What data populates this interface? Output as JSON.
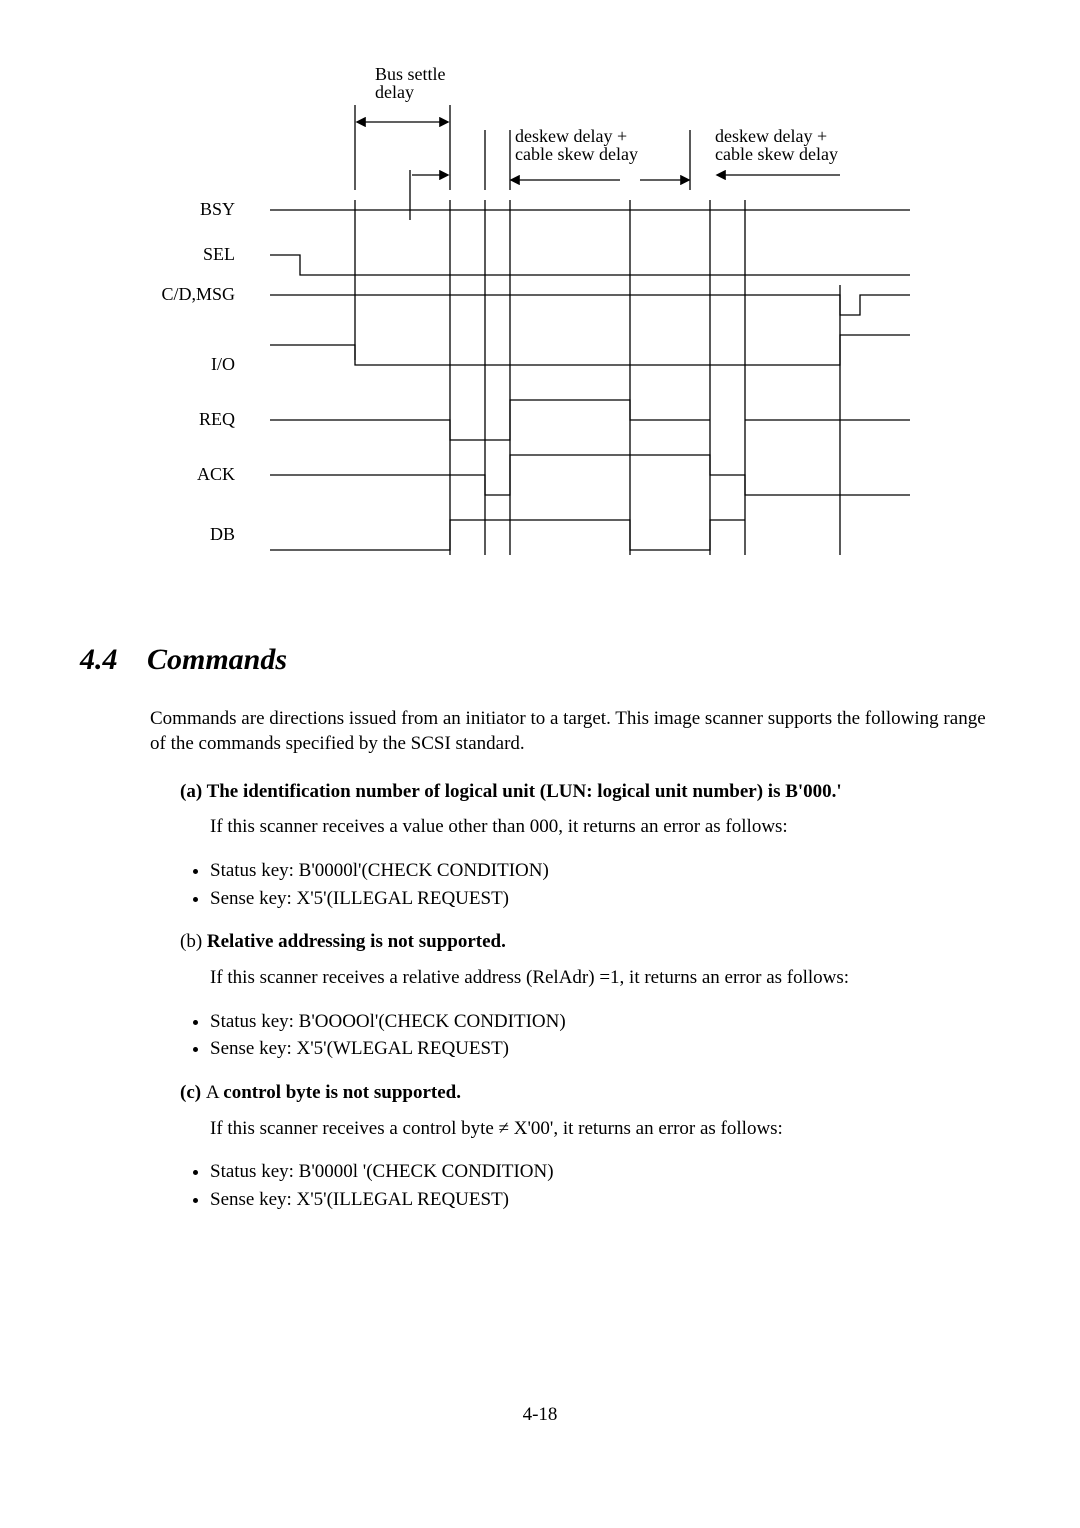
{
  "diagram": {
    "top_label": "Bus settle\ndelay",
    "mid_label1": "deskew delay +\ncable skew delay",
    "mid_label2": "deskew delay +\ncable skew delay",
    "signals": [
      "BSY",
      "SEL",
      "C/D,MSG",
      "I/O",
      "REQ",
      "ACK",
      "DB"
    ]
  },
  "section": {
    "number": "4.4",
    "title": "Commands"
  },
  "intro": "Commands are directions issued from an initiator to a target. This image scanner supports the following range of the commands specified by the SCSI standard.",
  "items": {
    "a": {
      "label": "(a) ",
      "bold": "The identification number of logical unit (LUN: logical unit number) is B'000.'",
      "lead": "If this scanner receives a value other than 000, it returns an error as follows:",
      "b1": "Status key: B'0000l'(CHECK CONDITION)",
      "b2": "Sense key: X'5'(ILLEGAL REQUEST)"
    },
    "b": {
      "label": "(b) ",
      "bold": "Relative addressing is not supported.",
      "lead": "If this scanner receives a relative address (RelAdr) =1, it returns an error as follows:",
      "b1": "Status key: B'OOOOl'(CHECK CONDITION)",
      "b2": "Sense key: X'5'(WLEGAL REQUEST)"
    },
    "c": {
      "label": "(c) ",
      "pre": "A ",
      "bold": "control byte is not supported.",
      "lead": "If this scanner receives a control byte ≠ X'00', it returns an error as follows:",
      "b1": "Status key: B'0000l '(CHECK CONDITION)",
      "b2": "Sense key: X'5'(ILLEGAL REQUEST)"
    }
  },
  "page": "4-18"
}
